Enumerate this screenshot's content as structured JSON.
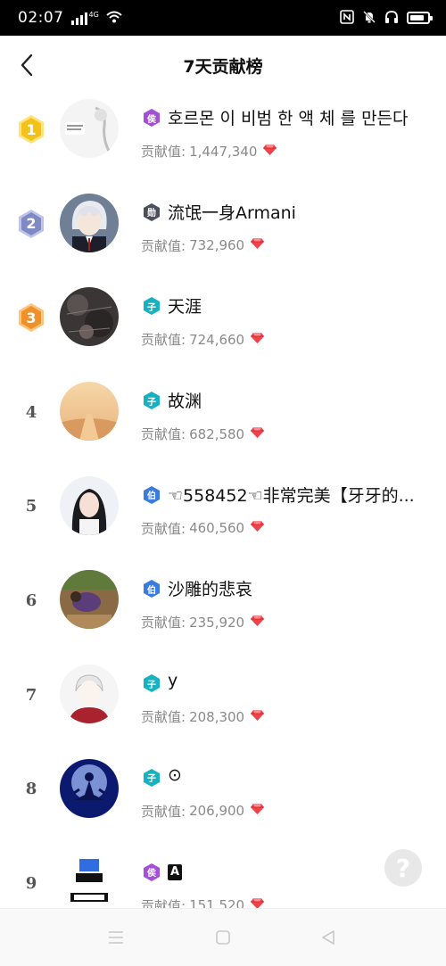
{
  "status_bar": {
    "time": "02:07",
    "network": "4G",
    "icons": [
      "signal-icon",
      "wifi-icon",
      "nfc-icon",
      "mute-icon",
      "headphones-icon",
      "battery-icon"
    ]
  },
  "nav": {
    "back_icon": "back-chevron-icon",
    "title": "7天贡献榜"
  },
  "contribution_label": "贡献值:",
  "list": [
    {
      "rank": "1",
      "rank_style": "gold",
      "badge": "侯",
      "badge_color": "#a44fd8",
      "name": "호르몬 이 비범 한 액 체 를 만든다",
      "value": "1,447,340",
      "avatar": "sketch"
    },
    {
      "rank": "2",
      "rank_style": "silver",
      "badge": "勋",
      "badge_color": "#4a4f5c",
      "name": "流氓一身Armani",
      "value": "732,960",
      "avatar": "anime-boy"
    },
    {
      "rank": "3",
      "rank_style": "bronze",
      "badge": "子",
      "badge_color": "#17b2c2",
      "name": "天涯",
      "value": "724,660",
      "avatar": "dark-texture"
    },
    {
      "rank": "4",
      "rank_style": "plain",
      "badge": "子",
      "badge_color": "#17b2c2",
      "name": "故渊",
      "value": "682,580",
      "avatar": "sunset"
    },
    {
      "rank": "5",
      "rank_style": "plain",
      "badge": "伯",
      "badge_color": "#3a7be0",
      "name": "☜558452☜非常完美【牙牙的...",
      "value": "460,560",
      "avatar": "girl"
    },
    {
      "rank": "6",
      "rank_style": "plain",
      "badge": "伯",
      "badge_color": "#3a7be0",
      "name": "沙雕的悲哀",
      "value": "235,920",
      "avatar": "outdoor"
    },
    {
      "rank": "7",
      "rank_style": "plain",
      "badge": "子",
      "badge_color": "#17b2c2",
      "name": "y",
      "value": "208,300",
      "avatar": "drawn-boy"
    },
    {
      "rank": "8",
      "rank_style": "plain",
      "badge": "子",
      "badge_color": "#17b2c2",
      "name": "⊙",
      "value": "206,900",
      "avatar": "meditation"
    },
    {
      "rank": "9",
      "rank_style": "plain",
      "badge": "侯",
      "badge_color": "#a44fd8",
      "name": "A",
      "value": "151,520",
      "avatar": "poster",
      "name_boxed": true
    }
  ],
  "help_button": "?",
  "colors": {
    "gold": "#f2c21b",
    "silver": "#8f9bd0",
    "bronze": "#f09a2b",
    "gem": "#f0424a",
    "muted_text": "#8a8a8a"
  }
}
